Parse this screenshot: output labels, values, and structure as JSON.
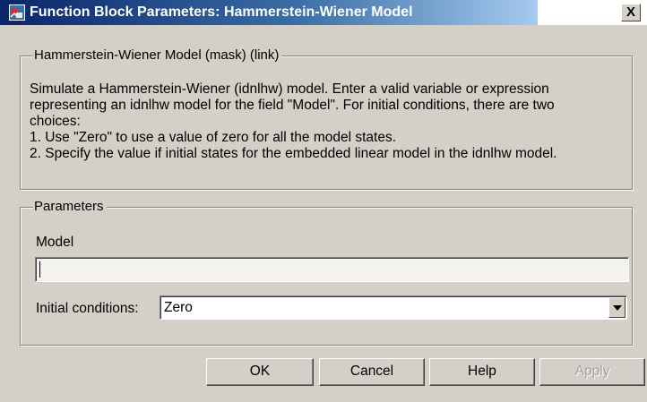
{
  "window": {
    "title": "Function Block Parameters: Hammerstein-Wiener Model",
    "close_label": "X",
    "app_icon": "simulink-block-icon"
  },
  "description_group": {
    "label": "Hammerstein-Wiener Model (mask) (link)",
    "lines": [
      "Simulate a Hammerstein-Wiener (idnlhw) model. Enter a valid variable or expression",
      "representing an idnlhw model for the field \"Model\". For initial conditions, there are two",
      "choices:",
      "1. Use \"Zero\" to use a value of zero for all the model states.",
      "2. Specify the value if initial states for the embedded linear model in the idnlhw model."
    ]
  },
  "parameters_group": {
    "label": "Parameters",
    "model_label": "Model",
    "model_value": "",
    "initial_conditions_label": "Initial conditions:",
    "initial_conditions_value": "Zero"
  },
  "buttons": {
    "ok": "OK",
    "cancel": "Cancel",
    "help": "Help",
    "apply": "Apply"
  },
  "colors": {
    "title_bar_start": "#0a246a",
    "title_bar_end": "#a6caf0",
    "dialog_face": "#d4d0c8"
  }
}
